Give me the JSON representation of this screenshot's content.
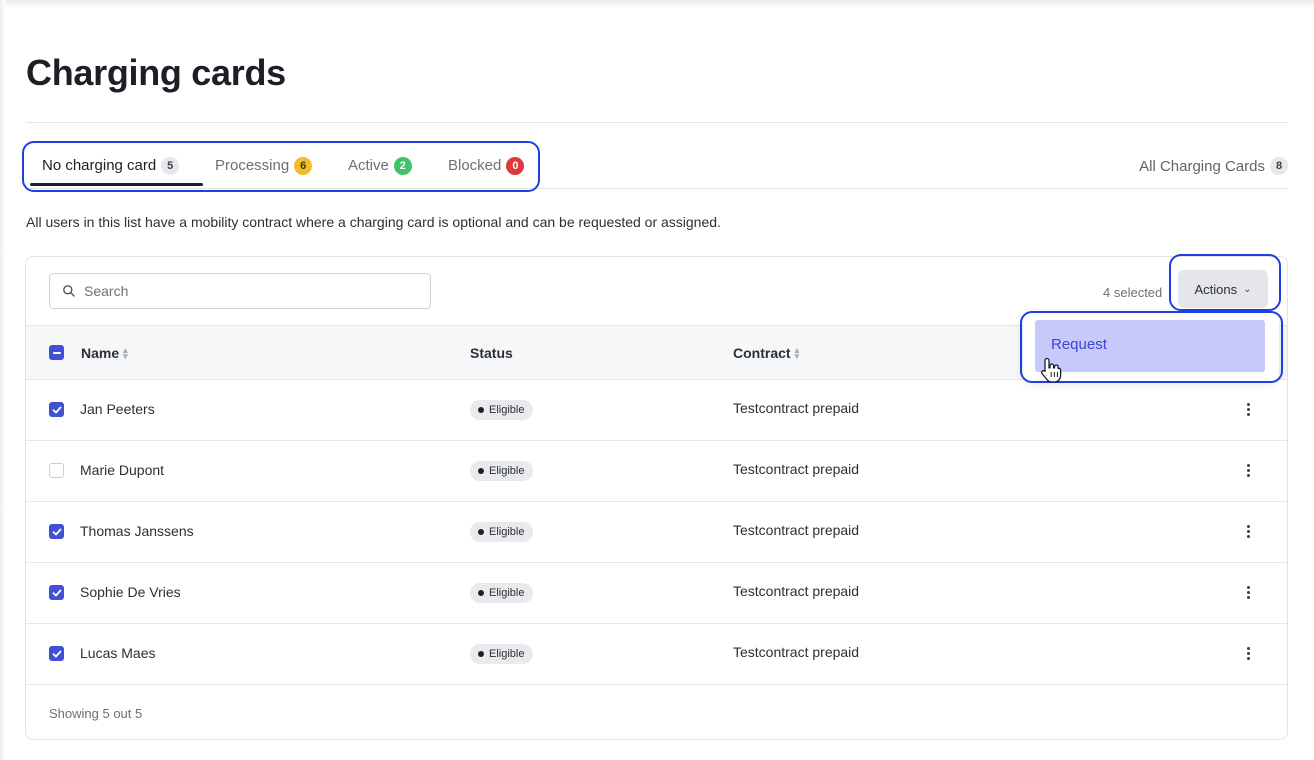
{
  "page": {
    "title": "Charging cards",
    "description": "All users in this list have a mobility contract where a charging card is optional and can be requested or assigned."
  },
  "tabs": [
    {
      "label": "No charging card",
      "count": "5",
      "active": true
    },
    {
      "label": "Processing",
      "count": "6",
      "color": "#f2bd2c"
    },
    {
      "label": "Active",
      "count": "2",
      "color": "#3fc46d"
    },
    {
      "label": "Blocked",
      "count": "0",
      "color": "#dd3b3b"
    }
  ],
  "all_cards": {
    "label": "All Charging Cards",
    "count": "8"
  },
  "toolbar": {
    "search_placeholder": "Search",
    "selected_text": "4 selected",
    "actions_label": "Actions"
  },
  "actions_menu": {
    "items": [
      {
        "label": "Request"
      }
    ]
  },
  "table": {
    "columns": {
      "name": "Name",
      "status": "Status",
      "contract": "Contract"
    },
    "select_all_state": "indeterminate",
    "rows": [
      {
        "name": "Jan Peeters",
        "status": "Eligible",
        "contract": "Testcontract prepaid",
        "checked": true
      },
      {
        "name": "Marie Dupont",
        "status": "Eligible",
        "contract": "Testcontract prepaid",
        "checked": false
      },
      {
        "name": "Thomas Janssens",
        "status": "Eligible",
        "contract": "Testcontract prepaid",
        "checked": true
      },
      {
        "name": "Sophie De Vries",
        "status": "Eligible",
        "contract": "Testcontract prepaid",
        "checked": true
      },
      {
        "name": "Lucas Maes",
        "status": "Eligible",
        "contract": "Testcontract prepaid",
        "checked": true
      }
    ],
    "footer": "Showing 5 out 5"
  },
  "colors": {
    "accent": "#4051d6",
    "highlight_annotation": "#1f3fe0",
    "menu_item_bg": "#c7c9fb"
  }
}
